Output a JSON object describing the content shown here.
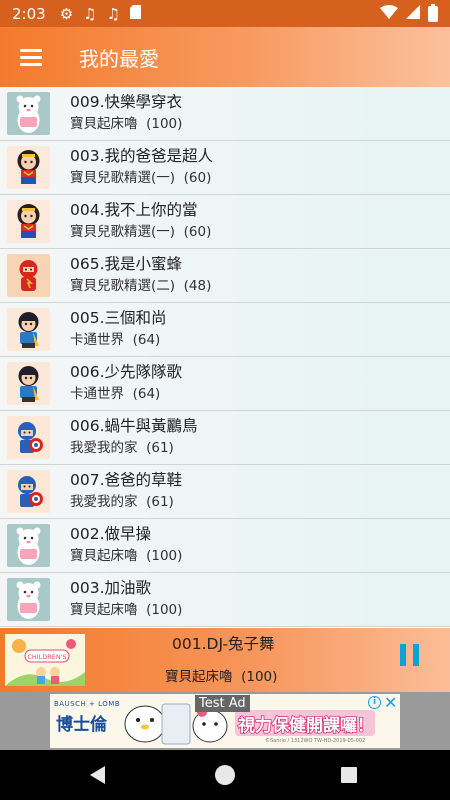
{
  "status_bar": {
    "time": "2:03",
    "icons": [
      "settings-gear-icon",
      "music-note-icon",
      "music-note-icon",
      "sd-card-icon",
      "wifi-icon",
      "signal-icon",
      "battery-icon"
    ]
  },
  "app_bar": {
    "title": "我的最愛",
    "menu_icon": "hamburger-menu-icon"
  },
  "songs": [
    {
      "title": "009.快樂學穿衣",
      "album": "寶貝起床嚕",
      "count": "(100)",
      "thumb": "bear"
    },
    {
      "title": "003.我的爸爸是超人",
      "album": "寶貝兒歌精選(一)",
      "count": "(60)",
      "thumb": "wonder"
    },
    {
      "title": "004.我不上你的當",
      "album": "寶貝兒歌精選(一)",
      "count": "(60)",
      "thumb": "wonder"
    },
    {
      "title": "065.我是小蜜蜂",
      "album": "寶貝兒歌精選(二)",
      "count": "(48)",
      "thumb": "flash"
    },
    {
      "title": "005.三個和尚",
      "album": "卡通世界",
      "count": "(64)",
      "thumb": "boy"
    },
    {
      "title": "006.少先隊隊歌",
      "album": "卡通世界",
      "count": "(64)",
      "thumb": "boy"
    },
    {
      "title": "006.蝸牛與黃鸝鳥",
      "album": "我愛我的家",
      "count": "(61)",
      "thumb": "cap"
    },
    {
      "title": "007.爸爸的草鞋",
      "album": "我愛我的家",
      "count": "(61)",
      "thumb": "cap"
    },
    {
      "title": "002.做早操",
      "album": "寶貝起床嚕",
      "count": "(100)",
      "thumb": "bear"
    },
    {
      "title": "003.加油歌",
      "album": "寶貝起床嚕",
      "count": "(100)",
      "thumb": "bear"
    }
  ],
  "now_playing": {
    "title": "001.DJ-兔子舞",
    "album": "寶貝起床嚕",
    "count": "(100)",
    "art_text": "CHILDREN'S",
    "control_icon": "pause-icon"
  },
  "ad": {
    "tag": "Test Ad",
    "brand_en": "BAUSCH + LOMB",
    "brand_zh": "博士倫",
    "slogan": "視力保健開課囉！",
    "fine_print": "©Sanrio / 1312WO  TW-HD-2019-05-002",
    "info_icon": "info-icon",
    "close_icon": "close-icon"
  },
  "nav_bar": {
    "icons": [
      "back-icon",
      "home-icon",
      "recent-apps-icon"
    ]
  },
  "colors": {
    "accent_orange": "#f47a2b",
    "pause_blue": "#0aa4d8",
    "list_bg": "#e8f4f4"
  }
}
